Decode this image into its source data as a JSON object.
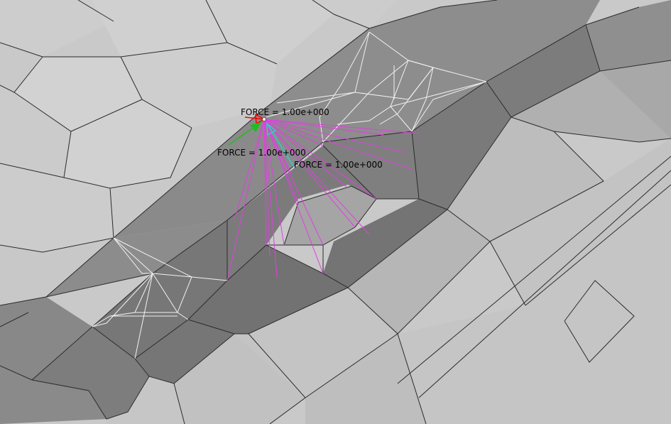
{
  "colors": {
    "background": "#c8c8c8",
    "light_faces": "#cbcbcb",
    "mid_faces": "#9a9a9a",
    "dark_faces": "#787878",
    "hole_fill": "#a3a3a3",
    "mesh_edges": "#2b2b2b",
    "detail_wire": "#f2f2f2",
    "rbe_spider": "#e040e0",
    "force_x": "#ff0000",
    "force_y": "#22bb22",
    "force_z": "#33cccc"
  },
  "forces": [
    {
      "id": "force-x",
      "label": "FORCE = 1.00e+000",
      "magnitude": 1.0,
      "icon": "red-arrow-icon"
    },
    {
      "id": "force-y",
      "label": "FORCE = 1.00e+000",
      "magnitude": 1.0,
      "icon": "green-arrow-icon"
    },
    {
      "id": "force-z",
      "label": "FORCE = 1.00e+000",
      "magnitude": 1.0,
      "icon": "cyan-arrow-icon"
    }
  ]
}
